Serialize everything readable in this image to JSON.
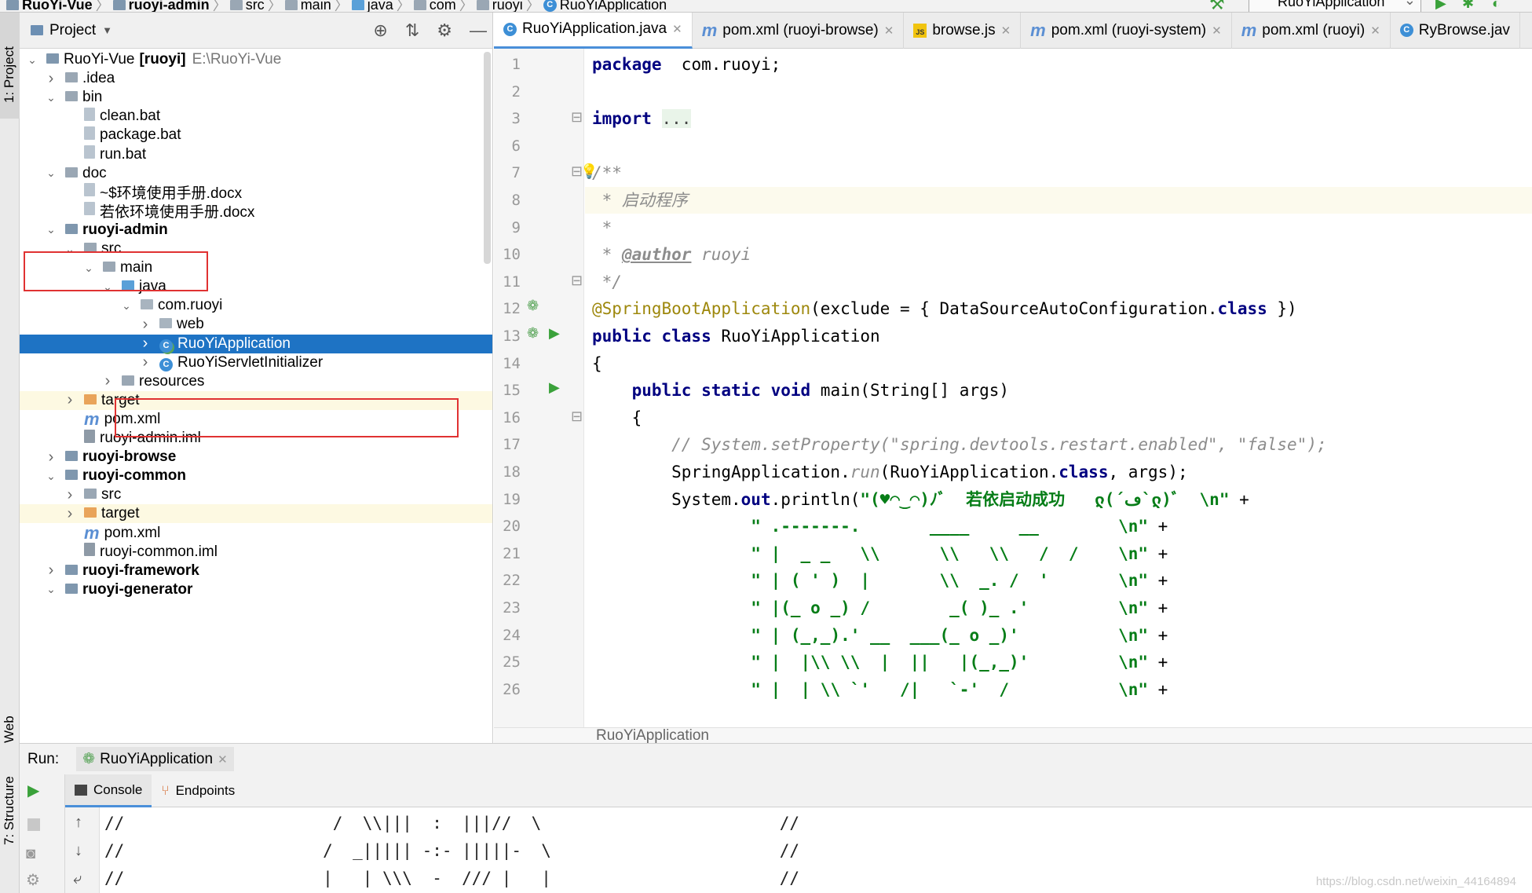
{
  "breadcrumb": {
    "items": [
      "RuoYi-Vue",
      "ruoyi-admin",
      "src",
      "main",
      "java",
      "com",
      "ruoyi",
      "RuoYiApplication"
    ],
    "run_config": "RuoYiApplication"
  },
  "side_tools": {
    "project": "1: Project",
    "web": "Web",
    "structure": "7: Structure"
  },
  "project_panel": {
    "title": "Project",
    "tree": [
      {
        "label": "RuoYi-Vue",
        "extra": "[ruoyi]",
        "path": "E:\\RuoYi-Vue",
        "depth": 0,
        "expanded": true,
        "icon": "module-folder-icon",
        "bold": false
      },
      {
        "label": ".idea",
        "depth": 1,
        "expanded": false,
        "icon": "folder-icon"
      },
      {
        "label": "bin",
        "depth": 1,
        "expanded": true,
        "icon": "folder-icon"
      },
      {
        "label": "clean.bat",
        "depth": 2,
        "icon": "bat-file-icon"
      },
      {
        "label": "package.bat",
        "depth": 2,
        "icon": "bat-file-icon"
      },
      {
        "label": "run.bat",
        "depth": 2,
        "icon": "bat-file-icon"
      },
      {
        "label": "doc",
        "depth": 1,
        "expanded": true,
        "icon": "folder-icon"
      },
      {
        "label": "~$环境使用手册.docx",
        "depth": 2,
        "icon": "doc-file-icon"
      },
      {
        "label": "若依环境使用手册.docx",
        "depth": 2,
        "icon": "doc-file-icon"
      },
      {
        "label": "ruoyi-admin",
        "depth": 1,
        "expanded": true,
        "icon": "module-folder-icon",
        "bold": true
      },
      {
        "label": "src",
        "depth": 2,
        "expanded": true,
        "icon": "folder-icon"
      },
      {
        "label": "main",
        "depth": 3,
        "expanded": true,
        "icon": "folder-icon"
      },
      {
        "label": "java",
        "depth": 4,
        "expanded": true,
        "icon": "source-folder-icon"
      },
      {
        "label": "com.ruoyi",
        "depth": 5,
        "expanded": true,
        "icon": "package-icon"
      },
      {
        "label": "web",
        "depth": 6,
        "expanded": false,
        "icon": "package-icon"
      },
      {
        "label": "RuoYiApplication",
        "depth": 6,
        "expanded": false,
        "icon": "spring-class-icon",
        "selected": true
      },
      {
        "label": "RuoYiServletInitializer",
        "depth": 6,
        "expanded": false,
        "icon": "class-icon"
      },
      {
        "label": "resources",
        "depth": 4,
        "expanded": false,
        "icon": "folder-icon"
      },
      {
        "label": "target",
        "depth": 2,
        "expanded": false,
        "icon": "excluded-folder-icon",
        "highlight": true
      },
      {
        "label": "pom.xml",
        "depth": 2,
        "icon": "maven-icon"
      },
      {
        "label": "ruoyi-admin.iml",
        "depth": 2,
        "icon": "iml-file-icon"
      },
      {
        "label": "ruoyi-browse",
        "depth": 1,
        "expanded": false,
        "icon": "module-folder-icon",
        "bold": true
      },
      {
        "label": "ruoyi-common",
        "depth": 1,
        "expanded": true,
        "icon": "module-folder-icon",
        "bold": true
      },
      {
        "label": "src",
        "depth": 2,
        "expanded": false,
        "icon": "folder-icon"
      },
      {
        "label": "target",
        "depth": 2,
        "expanded": false,
        "icon": "excluded-folder-icon",
        "highlight": true
      },
      {
        "label": "pom.xml",
        "depth": 2,
        "icon": "maven-icon"
      },
      {
        "label": "ruoyi-common.iml",
        "depth": 2,
        "icon": "iml-file-icon"
      },
      {
        "label": "ruoyi-framework",
        "depth": 1,
        "expanded": false,
        "icon": "module-folder-icon",
        "bold": true
      },
      {
        "label": "ruoyi-generator",
        "depth": 1,
        "expanded": true,
        "icon": "module-folder-icon",
        "bold": true
      }
    ]
  },
  "editor": {
    "tabs": [
      {
        "label": "RuoYiApplication.java",
        "icon": "class-icon",
        "active": true
      },
      {
        "label": "pom.xml (ruoyi-browse)",
        "icon": "maven-icon"
      },
      {
        "label": "browse.js",
        "icon": "js-icon"
      },
      {
        "label": "pom.xml (ruoyi-system)",
        "icon": "maven-icon"
      },
      {
        "label": "pom.xml (ruoyi)",
        "icon": "maven-icon"
      },
      {
        "label": "RyBrowse.jav",
        "icon": "class-icon"
      }
    ],
    "lines": [
      {
        "n": "1",
        "parts": [
          [
            "kw",
            "package"
          ],
          [
            "",
            "  com.ruoyi;"
          ]
        ]
      },
      {
        "n": "2",
        "parts": []
      },
      {
        "n": "3",
        "parts": [
          [
            "kw",
            "import"
          ],
          [
            "",
            " "
          ],
          [
            "fold",
            "..."
          ]
        ]
      },
      {
        "n": "6",
        "parts": []
      },
      {
        "n": "7",
        "parts": [
          [
            "com",
            "/**"
          ]
        ]
      },
      {
        "n": "8",
        "parts": [
          [
            "com",
            " * 启动程序"
          ]
        ],
        "current": true
      },
      {
        "n": "9",
        "parts": [
          [
            "com",
            " *"
          ]
        ]
      },
      {
        "n": "10",
        "parts": [
          [
            "com",
            " * "
          ],
          [
            "tag",
            "@author"
          ],
          [
            "com",
            " ruoyi"
          ]
        ]
      },
      {
        "n": "11",
        "parts": [
          [
            "com",
            " */"
          ]
        ]
      },
      {
        "n": "12",
        "parts": [
          [
            "ann",
            "@SpringBootApplication"
          ],
          [
            "",
            "(exclude = { DataSourceAutoConfiguration."
          ],
          [
            "kw",
            "class"
          ],
          [
            "",
            " })"
          ]
        ]
      },
      {
        "n": "13",
        "parts": [
          [
            "kw",
            "public class"
          ],
          [
            "",
            " RuoYiApplication"
          ]
        ]
      },
      {
        "n": "14",
        "parts": [
          [
            "",
            "{"
          ]
        ]
      },
      {
        "n": "15",
        "parts": [
          [
            "",
            "    "
          ],
          [
            "kw",
            "public static void"
          ],
          [
            "",
            " main(String[] args)"
          ]
        ]
      },
      {
        "n": "16",
        "parts": [
          [
            "",
            "    {"
          ]
        ]
      },
      {
        "n": "17",
        "parts": [
          [
            "",
            "        "
          ],
          [
            "com",
            "// System.setProperty(\"spring.devtools.restart.enabled\", \"false\");"
          ]
        ]
      },
      {
        "n": "18",
        "parts": [
          [
            "",
            "        SpringApplication."
          ],
          [
            "com",
            "run"
          ],
          [
            "",
            "(RuoYiApplication."
          ],
          [
            "kw",
            "class"
          ],
          [
            "",
            ", args);"
          ]
        ]
      },
      {
        "n": "19",
        "parts": [
          [
            "",
            "        System."
          ],
          [
            "kw",
            "out"
          ],
          [
            "",
            ".println("
          ],
          [
            "str",
            "\"(♥◠‿◠)ﾉﾞ  若依启动成功   ლ(´ڡ`ლ)ﾞ  \\n\""
          ],
          [
            "",
            " +"
          ]
        ]
      },
      {
        "n": "20",
        "parts": [
          [
            "",
            "                "
          ],
          [
            "str",
            "\" .-------.       ____     __        \\n\""
          ],
          [
            "",
            " +"
          ]
        ]
      },
      {
        "n": "21",
        "parts": [
          [
            "",
            "                "
          ],
          [
            "str",
            "\" |  _ _   \\\\      \\\\   \\\\   /  /    \\n\""
          ],
          [
            "",
            " +"
          ]
        ]
      },
      {
        "n": "22",
        "parts": [
          [
            "",
            "                "
          ],
          [
            "str",
            "\" | ( ' )  |       \\\\  _. /  '       \\n\""
          ],
          [
            "",
            " +"
          ]
        ]
      },
      {
        "n": "23",
        "parts": [
          [
            "",
            "                "
          ],
          [
            "str",
            "\" |(_ o _) /        _( )_ .'         \\n\""
          ],
          [
            "",
            " +"
          ]
        ]
      },
      {
        "n": "24",
        "parts": [
          [
            "",
            "                "
          ],
          [
            "str",
            "\" | (_,_).' __  ___(_ o _)'          \\n\""
          ],
          [
            "",
            " +"
          ]
        ]
      },
      {
        "n": "25",
        "parts": [
          [
            "",
            "                "
          ],
          [
            "str",
            "\" |  |\\\\ \\\\  |  ||   |(_,_)'         \\n\""
          ],
          [
            "",
            " +"
          ]
        ]
      },
      {
        "n": "26",
        "parts": [
          [
            "",
            "                "
          ],
          [
            "str",
            "\" |  | \\\\ `'   /|   `-'  /           \\n\""
          ],
          [
            "",
            " +"
          ]
        ]
      }
    ],
    "breadcrumb": "RuoYiApplication"
  },
  "run_panel": {
    "label": "Run:",
    "config_tab": "RuoYiApplication",
    "tabs": [
      "Console",
      "Endpoints"
    ],
    "console_lines": [
      "//                     /  \\\\|||  :  |||//  \\                        //",
      "//                    /  _||||| -:- |||||-  \\                       //",
      "//                    |   | \\\\\\  -  /// |   |                       //"
    ]
  },
  "watermark": "https://blog.csdn.net/weixin_44164894"
}
